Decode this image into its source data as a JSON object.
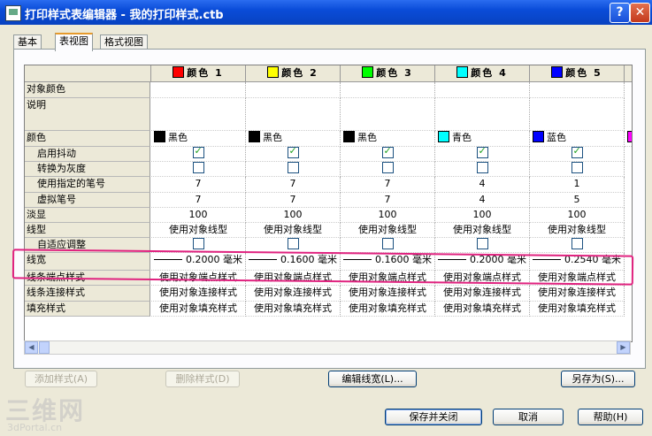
{
  "window": {
    "title": "打印样式表编辑器 - 我的打印样式.ctb",
    "help_glyph": "?",
    "close_glyph": "✕"
  },
  "tabs": [
    {
      "label": "基本",
      "active": false
    },
    {
      "label": "表视图",
      "active": true
    },
    {
      "label": "格式视图",
      "active": false
    }
  ],
  "table": {
    "columns": [
      {
        "name": "颜色 1",
        "color": "#ff0000"
      },
      {
        "name": "颜色 2",
        "color": "#ffff00"
      },
      {
        "name": "颜色 3",
        "color": "#00ff00"
      },
      {
        "name": "颜色 4",
        "color": "#00ffff"
      },
      {
        "name": "颜色 5",
        "color": "#0000ff"
      }
    ],
    "next_column_color": "#ff00ff",
    "rows": {
      "object_color": "对象颜色",
      "description": "说明",
      "color": "颜色",
      "dither": "启用抖动",
      "grayscale": "转换为灰度",
      "use_pen": "使用指定的笔号",
      "virtual_pen": "虚拟笔号",
      "screening": "淡显",
      "linetype": "线型",
      "adaptive": "自适应调整",
      "lineweight": "线宽",
      "line_end": "线条端点样式",
      "line_join": "线条连接样式",
      "fill": "填充样式"
    },
    "values": {
      "color": [
        {
          "text": "黑色",
          "swatch": "#000000"
        },
        {
          "text": "黑色",
          "swatch": "#000000"
        },
        {
          "text": "黑色",
          "swatch": "#000000"
        },
        {
          "text": "青色",
          "swatch": "#00ffff"
        },
        {
          "text": "蓝色",
          "swatch": "#0000ff"
        }
      ],
      "dither": [
        true,
        true,
        true,
        true,
        true
      ],
      "grayscale": [
        false,
        false,
        false,
        false,
        false
      ],
      "use_pen": [
        "7",
        "7",
        "7",
        "4",
        "1"
      ],
      "virtual_pen": [
        "7",
        "7",
        "7",
        "4",
        "5"
      ],
      "screening": [
        "100",
        "100",
        "100",
        "100",
        "100"
      ],
      "linetype": [
        "使用对象线型",
        "使用对象线型",
        "使用对象线型",
        "使用对象线型",
        "使用对象线型"
      ],
      "adaptive": [
        false,
        false,
        false,
        false,
        false
      ],
      "lineweight": [
        "0.2000 毫米",
        "0.1600 毫米",
        "0.1600 毫米",
        "0.2000 毫米",
        "0.2540 毫米"
      ],
      "line_end": [
        "使用对象端点样式",
        "使用对象端点样式",
        "使用对象端点样式",
        "使用对象端点样式",
        "使用对象端点样式"
      ],
      "line_join": [
        "使用对象连接样式",
        "使用对象连接样式",
        "使用对象连接样式",
        "使用对象连接样式",
        "使用对象连接样式"
      ],
      "fill": [
        "使用对象填充样式",
        "使用对象填充样式",
        "使用对象填充样式",
        "使用对象填充样式",
        "使用对象填充样式"
      ]
    }
  },
  "buttons": {
    "add_style": "添加样式(A)",
    "delete_style": "删除样式(D)",
    "edit_lineweight": "编辑线宽(L)...",
    "save_as": "另存为(S)...",
    "save_close": "保存并关闭",
    "cancel": "取消",
    "help": "帮助(H)"
  },
  "watermark": {
    "big": "三维网",
    "small": "3dPortal.cn"
  },
  "colors": {
    "highlight": "#e0227f"
  }
}
